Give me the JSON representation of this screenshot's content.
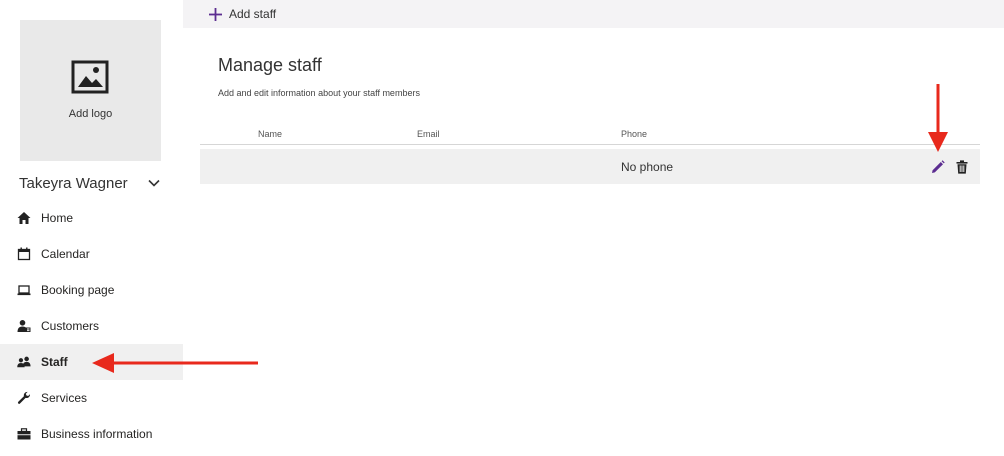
{
  "sidebar": {
    "logo": {
      "label": "Add logo",
      "icon": "image-icon"
    },
    "business_name": "Takeyra Wagner",
    "items": [
      {
        "label": "Home",
        "icon": "home-icon"
      },
      {
        "label": "Calendar",
        "icon": "calendar-icon"
      },
      {
        "label": "Booking page",
        "icon": "laptop-icon"
      },
      {
        "label": "Customers",
        "icon": "customers-icon"
      },
      {
        "label": "Staff",
        "icon": "staff-icon",
        "active": true
      },
      {
        "label": "Services",
        "icon": "wrench-icon"
      },
      {
        "label": "Business information",
        "icon": "briefcase-icon"
      }
    ]
  },
  "toolbar": {
    "add_staff_label": "Add staff"
  },
  "main": {
    "title": "Manage staff",
    "subtitle": "Add and edit information about your staff members",
    "columns": [
      "Name",
      "Email",
      "Phone"
    ],
    "rows": [
      {
        "name": "",
        "email": "",
        "phone": "No phone"
      }
    ]
  },
  "colors": {
    "accent": "#5c2d91",
    "annotation": "#e8291c",
    "sidebar_active_bg": "#f0f0f0",
    "row_bg": "#f0f0f0",
    "topbar_bg": "#f4f3f5"
  }
}
